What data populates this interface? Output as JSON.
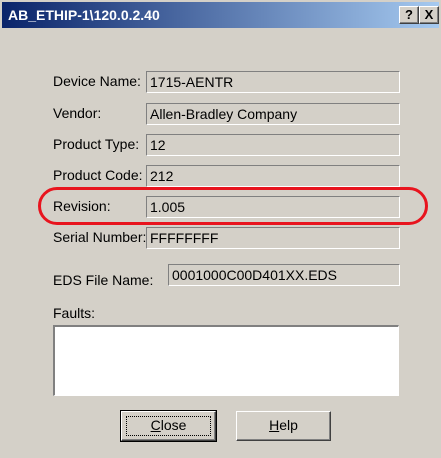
{
  "window": {
    "title": "AB_ETHIP-1\\120.0.2.40",
    "help_button": "?",
    "close_button": "X"
  },
  "fields": [
    {
      "label": "Device Name:",
      "value": "1715-AENTR"
    },
    {
      "label": "Vendor:",
      "value": "Allen-Bradley Company"
    },
    {
      "label": "Product Type:",
      "value": "12"
    },
    {
      "label": "Product Code:",
      "value": "212"
    },
    {
      "label": "Revision:",
      "value": "1.005"
    },
    {
      "label": "Serial Number:",
      "value": "FFFFFFFF"
    }
  ],
  "eds": {
    "label": "EDS File Name:",
    "value": "0001000C00D401XX.EDS"
  },
  "faults": {
    "label": "Faults:",
    "value": ""
  },
  "buttons": {
    "close_label_first": "C",
    "close_label_rest": "lose",
    "help_label_first": "H",
    "help_label_rest": "elp"
  },
  "highlight_color": "#e8141e"
}
